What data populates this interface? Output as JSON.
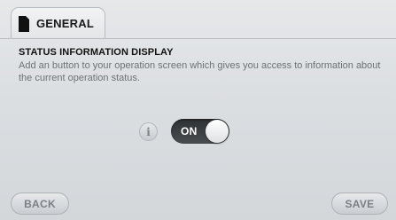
{
  "tab": {
    "label": "GENERAL",
    "icon": "document-icon"
  },
  "section": {
    "title": "STATUS INFORMATION DISPLAY",
    "description": "Add an button to your operation screen which gives you access to information about the current operation status."
  },
  "info_button": {
    "glyph": "i",
    "icon": "info-icon"
  },
  "toggle": {
    "label": "ON",
    "state": "on"
  },
  "footer": {
    "back_label": "BACK",
    "save_label": "SAVE"
  }
}
